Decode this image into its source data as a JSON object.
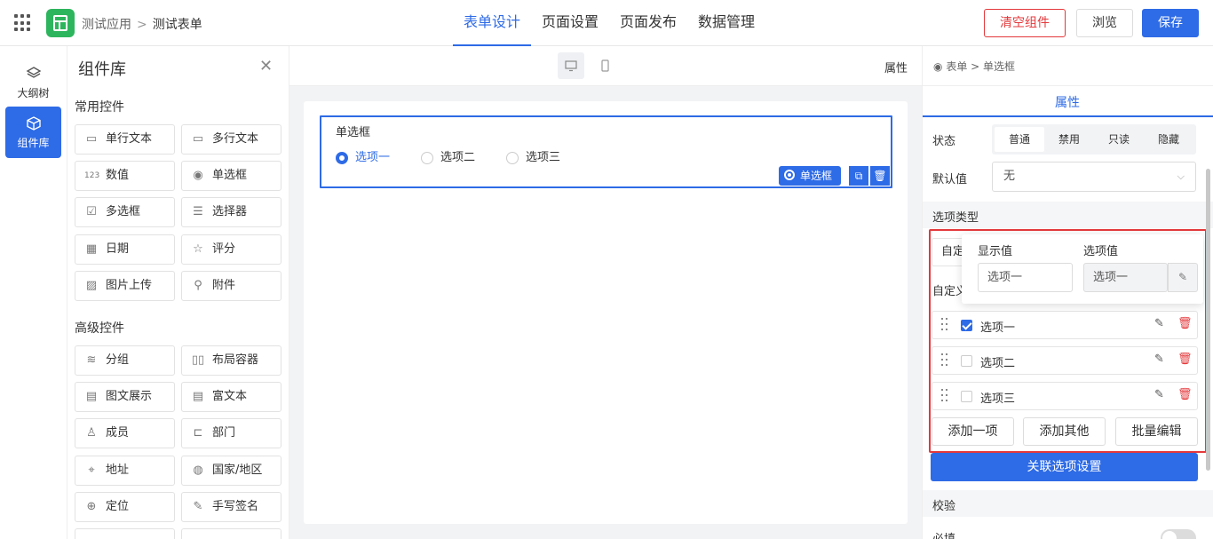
{
  "header": {
    "breadcrumb_app": "测试应用",
    "breadcrumb_sep": ">",
    "breadcrumb_form": "测试表单",
    "tabs": [
      "表单设计",
      "页面设置",
      "页面发布",
      "数据管理"
    ],
    "active_tab": "表单设计",
    "clear_label": "清空组件",
    "browse_label": "浏览",
    "save_label": "保存"
  },
  "leftnav": {
    "items": [
      {
        "label": "大纲树",
        "icon": "layers-icon"
      },
      {
        "label": "组件库",
        "icon": "cube-icon"
      }
    ],
    "active": "组件库"
  },
  "library": {
    "title": "组件库",
    "common_title": "常用控件",
    "common": [
      {
        "label": "单行文本",
        "icon": "single-line-text-icon"
      },
      {
        "label": "多行文本",
        "icon": "multi-line-text-icon"
      },
      {
        "label": "数值",
        "icon": "number-icon"
      },
      {
        "label": "单选框",
        "icon": "radio-icon"
      },
      {
        "label": "多选框",
        "icon": "checkbox-icon"
      },
      {
        "label": "选择器",
        "icon": "select-icon"
      },
      {
        "label": "日期",
        "icon": "calendar-icon"
      },
      {
        "label": "评分",
        "icon": "star-icon"
      },
      {
        "label": "图片上传",
        "icon": "image-icon"
      },
      {
        "label": "附件",
        "icon": "paperclip-icon"
      }
    ],
    "advanced_title": "高级控件",
    "advanced": [
      {
        "label": "分组",
        "icon": "group-icon"
      },
      {
        "label": "布局容器",
        "icon": "layout-icon"
      },
      {
        "label": "图文展示",
        "icon": "image-text-icon"
      },
      {
        "label": "富文本",
        "icon": "rich-text-icon"
      },
      {
        "label": "成员",
        "icon": "user-icon"
      },
      {
        "label": "部门",
        "icon": "department-icon"
      },
      {
        "label": "地址",
        "icon": "location-icon"
      },
      {
        "label": "国家/地区",
        "icon": "globe-icon"
      },
      {
        "label": "定位",
        "icon": "crosshair-icon"
      },
      {
        "label": "手写签名",
        "icon": "pen-icon"
      }
    ]
  },
  "canvas": {
    "properties_label": "属性",
    "field": {
      "label": "单选框",
      "options": [
        "选项一",
        "选项二",
        "选项三"
      ],
      "selected": "选项一",
      "tag_label": "单选框"
    }
  },
  "properties": {
    "breadcrumb_root": "表单",
    "breadcrumb_sep": ">",
    "breadcrumb_current": "单选框",
    "tab": "属性",
    "state_label": "状态",
    "state_options": [
      "普通",
      "禁用",
      "只读",
      "隐藏"
    ],
    "state_selected": "普通",
    "default_label": "默认值",
    "default_value": "无",
    "option_type_title": "选项类型",
    "option_type_value": "自定",
    "custom_label": "自定义",
    "popup": {
      "display_label": "显示值",
      "value_label": "选项值",
      "display_value": "选项一",
      "option_value": "选项一"
    },
    "options": [
      {
        "label": "选项一",
        "checked": true
      },
      {
        "label": "选项二",
        "checked": false
      },
      {
        "label": "选项三",
        "checked": false
      }
    ],
    "add_one": "添加一项",
    "add_other": "添加其他",
    "batch_edit": "批量编辑",
    "link_settings": "关联选项设置",
    "validation_title": "校验",
    "required_label": "必填",
    "required_on": false
  },
  "colors": {
    "primary": "#2e6be6",
    "danger": "#e4393c",
    "logo": "#2db55d"
  }
}
